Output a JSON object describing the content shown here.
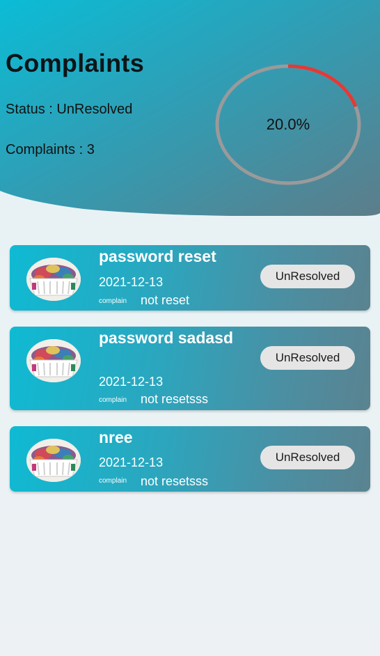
{
  "header": {
    "title": "Complaints",
    "status_text": "Status : UnResolved",
    "count_text": "Complaints : 3",
    "progress_label": "20.0%",
    "progress_fraction": 0.2,
    "colors": {
      "gradient_start": "#0bbcd6",
      "gradient_end": "#5d7d8a",
      "ring_track": "#9a9a9a",
      "ring_progress": "#e53935"
    }
  },
  "complaints": [
    {
      "title": "password reset",
      "date": "2021-12-13",
      "caption": "complain",
      "description": "not reset",
      "status": "UnResolved",
      "image_icon": "laundry-basket-image"
    },
    {
      "title": "password sadasd",
      "date": "2021-12-13",
      "caption": "complain",
      "description": "not resetsss",
      "status": "UnResolved",
      "image_icon": "laundry-basket-image"
    },
    {
      "title": "nree",
      "date": "2021-12-13",
      "caption": "complain",
      "description": "not resetsss",
      "status": "UnResolved",
      "image_icon": "laundry-basket-image"
    }
  ]
}
